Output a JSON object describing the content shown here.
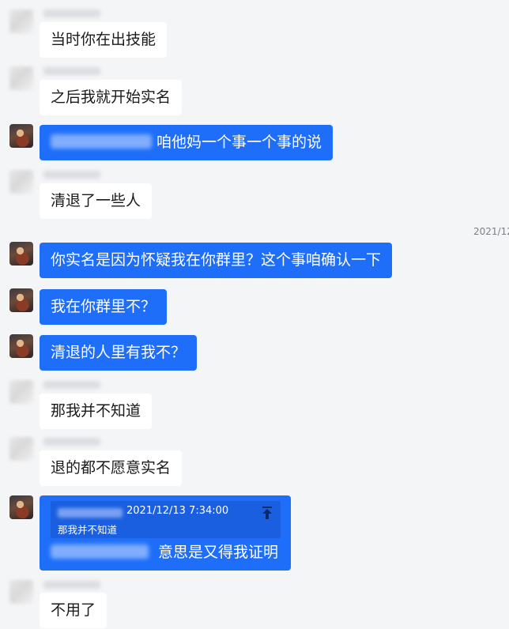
{
  "timestamp_divider": "2021/12",
  "messages": [
    {
      "side": "in",
      "text": "当时你在出技能"
    },
    {
      "side": "in",
      "text": "之后我就开始实名"
    },
    {
      "side": "out",
      "text": "咱他妈一个事一个事的说",
      "has_mention": true
    },
    {
      "side": "in",
      "text": "清退了一些人"
    },
    {
      "side": "out",
      "text": "你实名是因为怀疑我在你群里？这个事咱确认一下"
    },
    {
      "side": "out",
      "text": "我在你群里不？"
    },
    {
      "side": "out",
      "text": "清退的人里有我不？"
    },
    {
      "side": "in",
      "text": "那我并不知道"
    },
    {
      "side": "in",
      "text": "退的都不愿意实名"
    },
    {
      "side": "out",
      "reply": {
        "quoted_time": "2021/12/13 7:34:00",
        "quoted_text": "那我并不知道",
        "icon": "jump-to-quote-icon"
      },
      "text": "意思是又得我证明",
      "has_mention": true
    },
    {
      "side": "in",
      "text": "不用了"
    }
  ],
  "colors": {
    "background": "#f4f5f7",
    "incoming_bubble": "#ffffff",
    "outgoing_bubble": "#1e6efa",
    "quote_box": "#1a5fe0"
  }
}
